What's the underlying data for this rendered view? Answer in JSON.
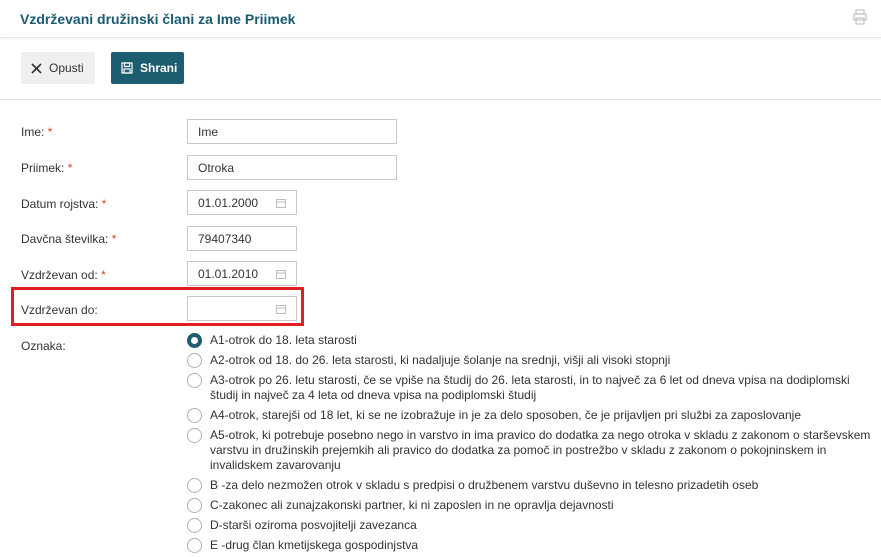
{
  "header": {
    "title": "Vzdrževani družinski člani za Ime Priimek",
    "icon": "print-icon"
  },
  "toolbar": {
    "cancel_label": "Opusti",
    "save_label": "Shrani"
  },
  "form": {
    "required_marker": "*",
    "fields": {
      "ime": {
        "label": "Ime:",
        "value": "Ime"
      },
      "priimek": {
        "label": "Priimek:",
        "value": "Otroka"
      },
      "datum_rojstva": {
        "label": "Datum rojstva:",
        "value": "01.01.2000"
      },
      "davcna": {
        "label": "Davčna številka:",
        "value": "79407340"
      },
      "vzdrzevan_od": {
        "label": "Vzdrževan od:",
        "value": "01.01.2010"
      },
      "vzdrzevan_do": {
        "label": "Vzdrževan do:",
        "value": ""
      }
    },
    "oznaka_label": "Oznaka:",
    "oznaka_selected": 0,
    "oznaka_options": [
      "A1-otrok do 18. leta starosti",
      "A2-otrok od 18. do 26. leta starosti, ki nadaljuje šolanje na srednji, višji ali visoki stopnji",
      "A3-otrok po 26. letu starosti, če se vpiše na študij do 26. leta starosti, in to največ za 6 let od dneva vpisa na dodiplomski študij in največ za 4 leta od dneva vpisa na podiplomski študij",
      "A4-otrok, starejši od 18 let, ki se ne izobražuje in je za delo sposoben, če je prijavljen pri službi za zaposlovanje",
      "A5-otrok, ki potrebuje posebno nego in varstvo in ima pravico do dodatka za nego otroka v skladu z zakonom o starševskem varstvu in družinskih prejemkih ali pravico do dodatka za pomoč in postrežbo v skladu z zakonom o pokojninskem in invalidskem zavarovanju",
      "B -za delo nezmožen otrok v skladu s predpisi o družbenem varstvu duševno in telesno prizadetih oseb",
      "C-zakonec ali zunajzakonski partner, ki ni zaposlen in ne opravlja dejavnosti",
      "D-starši oziroma posvojitelji zavezanca",
      "E -drug član kmetijskega gospodinjstva"
    ]
  },
  "colors": {
    "accent": "#1c5d70",
    "title": "#1b5b72",
    "required": "#d9412b",
    "highlight": "#e02020"
  }
}
